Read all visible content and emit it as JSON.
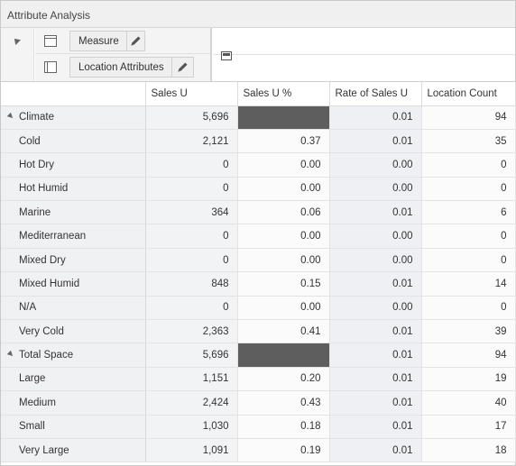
{
  "window": {
    "title": "Attribute Analysis"
  },
  "pivot": {
    "rows_tile": {
      "label": "Measure",
      "icon": "pencil-icon"
    },
    "cols_tile": {
      "label": "Location Attributes",
      "icon": "pencil-icon"
    }
  },
  "table": {
    "headers": [
      "",
      "Sales U",
      "Sales U %",
      "Rate of Sales U",
      "Location Count"
    ],
    "rows": [
      {
        "label": "Climate",
        "group": true,
        "cells": [
          "5,696",
          "",
          "0.01",
          "94"
        ],
        "dark": [
          false,
          true,
          false,
          false
        ]
      },
      {
        "label": "Cold",
        "group": false,
        "cells": [
          "2,121",
          "0.37",
          "0.01",
          "35"
        ],
        "dark": [
          false,
          false,
          false,
          false
        ]
      },
      {
        "label": "Hot Dry",
        "group": false,
        "cells": [
          "0",
          "0.00",
          "0.00",
          "0"
        ],
        "dark": [
          false,
          false,
          false,
          false
        ]
      },
      {
        "label": "Hot Humid",
        "group": false,
        "cells": [
          "0",
          "0.00",
          "0.00",
          "0"
        ],
        "dark": [
          false,
          false,
          false,
          false
        ]
      },
      {
        "label": "Marine",
        "group": false,
        "cells": [
          "364",
          "0.06",
          "0.01",
          "6"
        ],
        "dark": [
          false,
          false,
          false,
          false
        ]
      },
      {
        "label": "Mediterranean",
        "group": false,
        "cells": [
          "0",
          "0.00",
          "0.00",
          "0"
        ],
        "dark": [
          false,
          false,
          false,
          false
        ]
      },
      {
        "label": "Mixed Dry",
        "group": false,
        "cells": [
          "0",
          "0.00",
          "0.00",
          "0"
        ],
        "dark": [
          false,
          false,
          false,
          false
        ]
      },
      {
        "label": "Mixed Humid",
        "group": false,
        "cells": [
          "848",
          "0.15",
          "0.01",
          "14"
        ],
        "dark": [
          false,
          false,
          false,
          false
        ]
      },
      {
        "label": "N/A",
        "group": false,
        "cells": [
          "0",
          "0.00",
          "0.00",
          "0"
        ],
        "dark": [
          false,
          false,
          false,
          false
        ]
      },
      {
        "label": "Very Cold",
        "group": false,
        "cells": [
          "2,363",
          "0.41",
          "0.01",
          "39"
        ],
        "dark": [
          false,
          false,
          false,
          false
        ]
      },
      {
        "label": "Total Space",
        "group": true,
        "cells": [
          "5,696",
          "",
          "0.01",
          "94"
        ],
        "dark": [
          false,
          true,
          false,
          false
        ]
      },
      {
        "label": "Large",
        "group": false,
        "cells": [
          "1,151",
          "0.20",
          "0.01",
          "19"
        ],
        "dark": [
          false,
          false,
          false,
          false
        ]
      },
      {
        "label": "Medium",
        "group": false,
        "cells": [
          "2,424",
          "0.43",
          "0.01",
          "40"
        ],
        "dark": [
          false,
          false,
          false,
          false
        ]
      },
      {
        "label": "Small",
        "group": false,
        "cells": [
          "1,030",
          "0.18",
          "0.01",
          "17"
        ],
        "dark": [
          false,
          false,
          false,
          false
        ]
      },
      {
        "label": "Very Large",
        "group": false,
        "cells": [
          "1,091",
          "0.19",
          "0.01",
          "18"
        ],
        "dark": [
          false,
          false,
          false,
          false
        ]
      }
    ]
  },
  "colors": {
    "dark_cell": "#5e5e5e",
    "row_header_bg": "#f0f1f3"
  }
}
